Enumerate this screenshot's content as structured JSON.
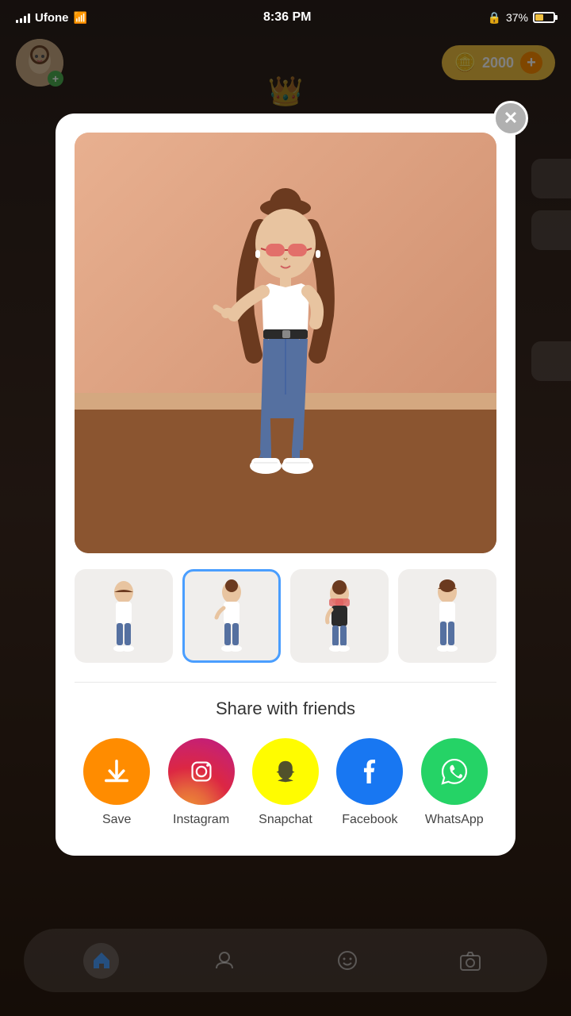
{
  "status_bar": {
    "carrier": "Ufone",
    "time": "8:36 PM",
    "battery_percent": "37%",
    "lock_icon": "🔒"
  },
  "bg": {
    "coins": "2000",
    "plus_label": "+",
    "crown_icon": "👑"
  },
  "modal": {
    "close_icon": "✕",
    "share_title": "Share with friends",
    "thumbnails": [
      {
        "id": 1,
        "active": false
      },
      {
        "id": 2,
        "active": true
      },
      {
        "id": 3,
        "active": false
      },
      {
        "id": 4,
        "active": false
      }
    ],
    "share_apps": [
      {
        "id": "save",
        "label": "Save",
        "icon_class": "icon-save",
        "icon": "⬇"
      },
      {
        "id": "instagram",
        "label": "Instagram",
        "icon_class": "icon-instagram",
        "icon": "📷"
      },
      {
        "id": "snapchat",
        "label": "Snapchat",
        "icon_class": "icon-snapchat",
        "icon": "👻"
      },
      {
        "id": "facebook",
        "label": "Facebook",
        "icon_class": "icon-facebook",
        "icon": "f"
      },
      {
        "id": "whatsapp",
        "label": "WhatsApp",
        "icon_class": "icon-whatsapp",
        "icon": "📱"
      }
    ]
  },
  "bottom_nav": {
    "icons": [
      "home",
      "contacts",
      "emoji",
      "camera"
    ]
  }
}
